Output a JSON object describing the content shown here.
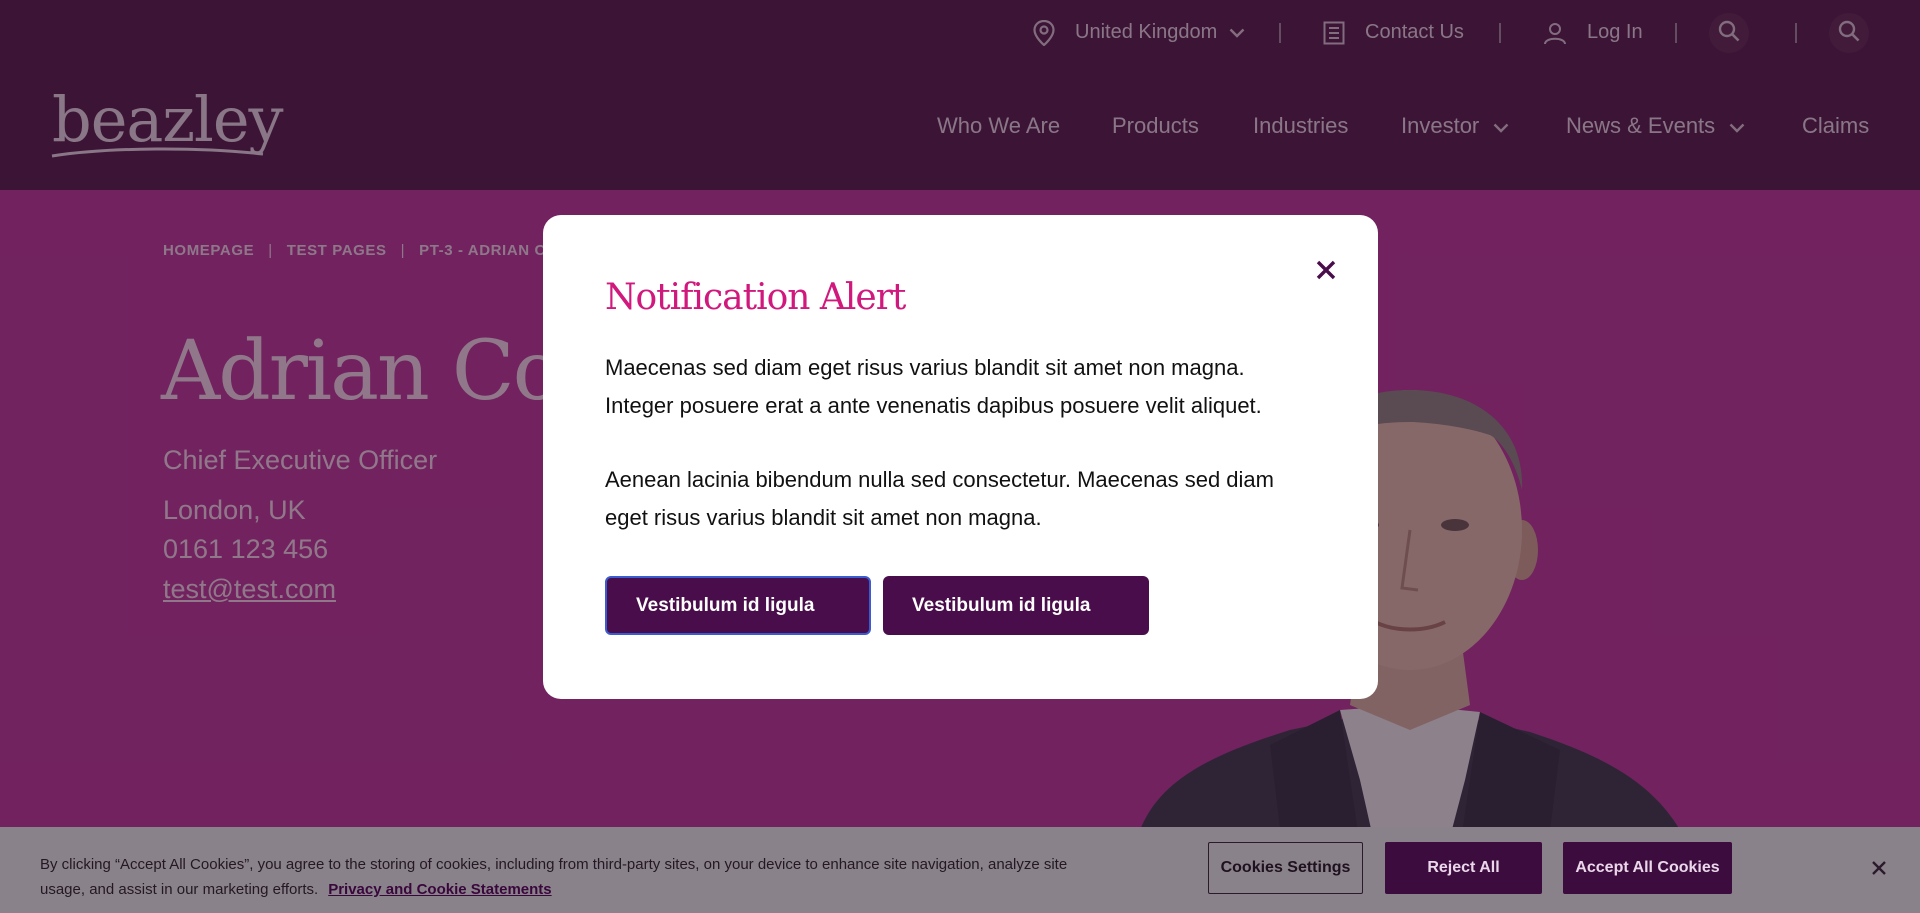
{
  "utility": {
    "country": "United Kingdom",
    "contact": "Contact Us",
    "login": "Log In",
    "icons": [
      "location-pin-icon",
      "chevron-down-icon",
      "contact-card-icon",
      "user-icon",
      "search-icon"
    ]
  },
  "header": {
    "logo_text": "beazley",
    "nav": [
      "Who We Are",
      "Products",
      "Industries",
      "Investor",
      "News & Events",
      "Claims"
    ]
  },
  "breadcrumb": {
    "items": [
      "HOMEPAGE",
      "TEST PAGES",
      "PT-3 - ADRIAN C"
    ],
    "separator": "|"
  },
  "profile": {
    "name": "Adrian Cox",
    "title": "Chief Executive Officer",
    "location": "London, UK",
    "phone": "0161 123 456",
    "email": "test@test.com"
  },
  "modal": {
    "title": "Notification Alert",
    "paragraph1": "Maecenas sed diam eget risus varius blandit sit amet non magna. Integer posuere erat a ante venenatis dapibus posuere velit aliquet.",
    "paragraph2": "Aenean lacinia bibendum nulla sed consectetur. Maecenas sed diam eget risus varius blandit sit amet non magna.",
    "button_primary": "Vestibulum id ligula",
    "button_secondary": "Vestibulum id ligula"
  },
  "cookies": {
    "text": "By clicking “Accept All Cookies”, you agree to the storing of cookies, including from third-party sites, on your device to enhance site navigation, analyze site usage, and assist in our marketing efforts.",
    "link": "Privacy and Cookie Statements",
    "settings": "Cookies Settings",
    "reject": "Reject All",
    "accept": "Accept All Cookies"
  },
  "colors": {
    "header_bg": "#54204d",
    "hero_bg": "#b83b9c",
    "modal_title": "#d1197d",
    "button_bg": "#4a0d4b"
  }
}
